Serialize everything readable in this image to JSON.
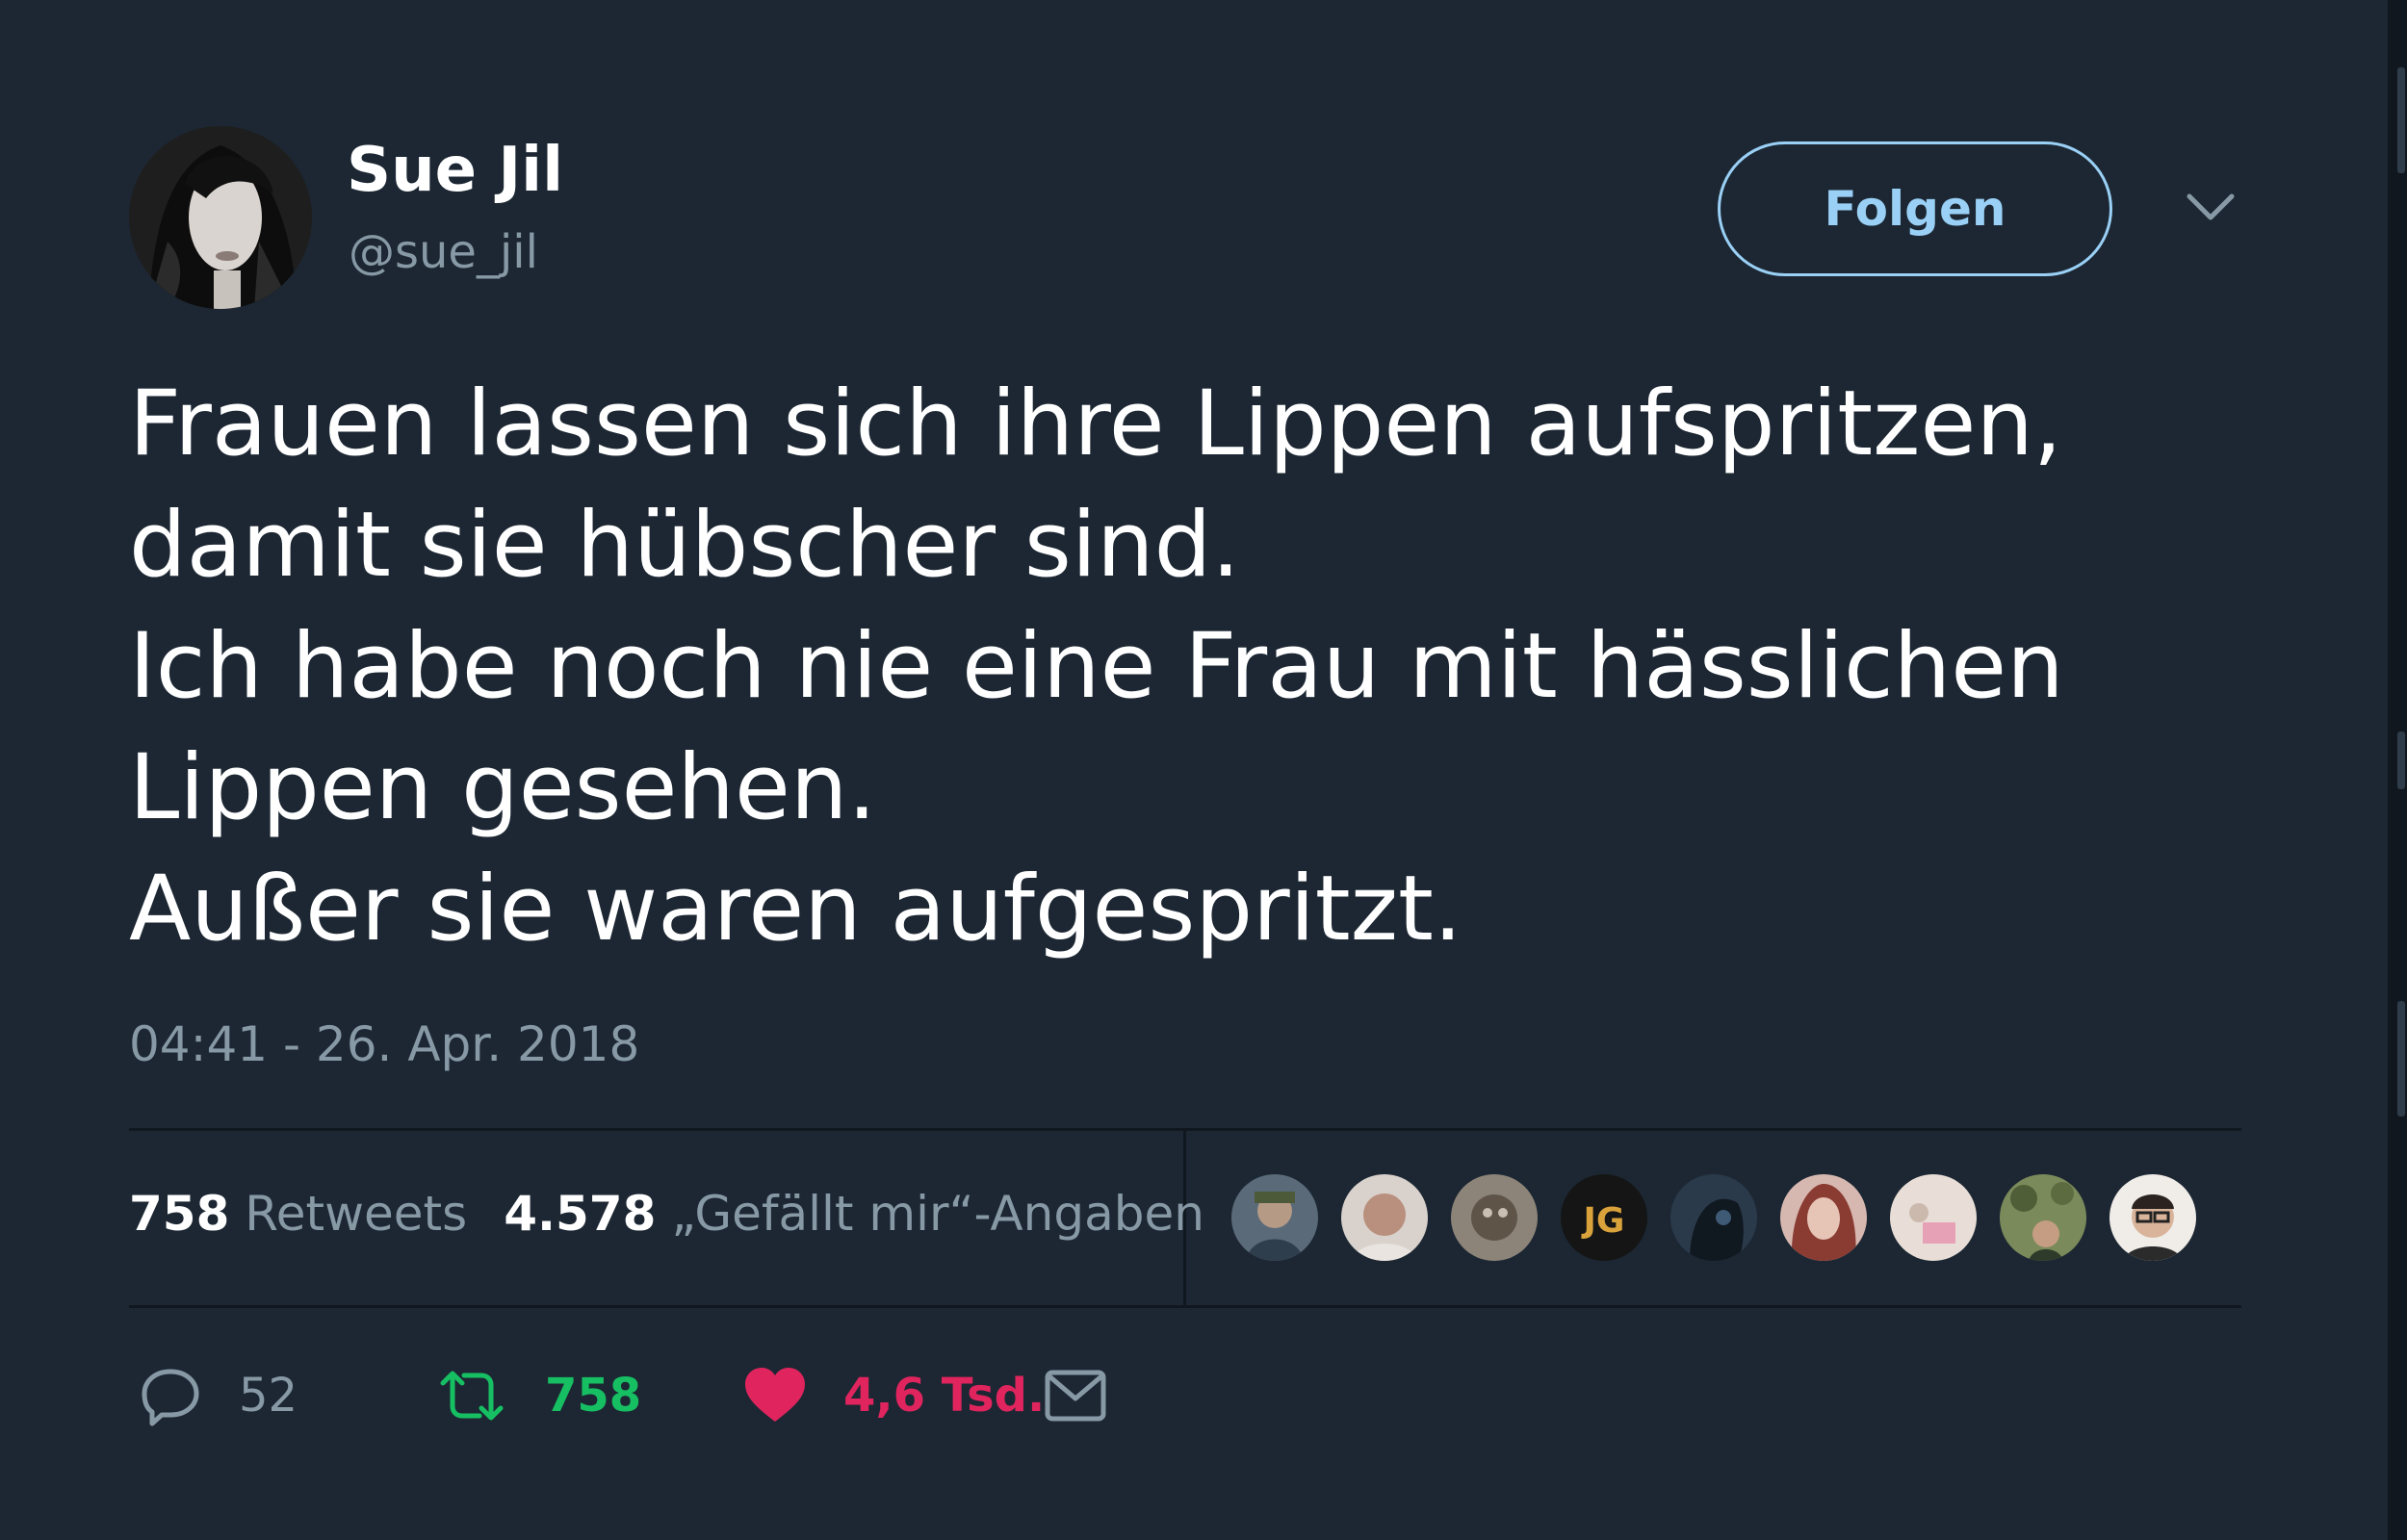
{
  "author": {
    "display_name": "Sue Jil",
    "handle": "@sue_jil"
  },
  "header": {
    "follow_label": "Folgen",
    "menu_icon": "chevron-down-icon"
  },
  "tweet": {
    "lines": [
      "Frauen lassen sich ihre Lippen aufspritzen,",
      "damit sie hübscher sind.",
      "Ich habe noch nie eine Frau mit hässlichen",
      "Lippen gesehen.",
      "Außer sie waren aufgespritzt."
    ],
    "timestamp": "04:41 - 26. Apr. 2018"
  },
  "stats": {
    "retweets_count": "758",
    "retweets_label": "Retweets",
    "likes_count": "4.578",
    "likes_label": "„Gefällt mir“-Angaben"
  },
  "likers": [
    {
      "icon": "avatar-liker-1",
      "color": "#5a6a78"
    },
    {
      "icon": "avatar-liker-2",
      "color": "#c9c2bd"
    },
    {
      "icon": "avatar-liker-3",
      "color": "#7f7467"
    },
    {
      "icon": "avatar-liker-4",
      "color": "#1b1b1b"
    },
    {
      "icon": "avatar-liker-5",
      "color": "#2b3a4a"
    },
    {
      "icon": "avatar-liker-6",
      "color": "#b57b73"
    },
    {
      "icon": "avatar-liker-7",
      "color": "#e2d6cf"
    },
    {
      "icon": "avatar-liker-8",
      "color": "#6f7d52"
    },
    {
      "icon": "avatar-liker-9",
      "color": "#e9e4e0"
    }
  ],
  "actions": {
    "reply_count": "52",
    "retweet_count": "758",
    "like_count": "4,6 Tsd.",
    "reply_icon": "reply-icon",
    "retweet_icon": "retweet-icon",
    "like_icon": "heart-icon",
    "message_icon": "envelope-icon"
  },
  "colors": {
    "background": "#1c2733",
    "accent": "#9ad0f5",
    "retweet": "#17bf63",
    "like": "#e0245e",
    "muted": "#8899a6"
  }
}
